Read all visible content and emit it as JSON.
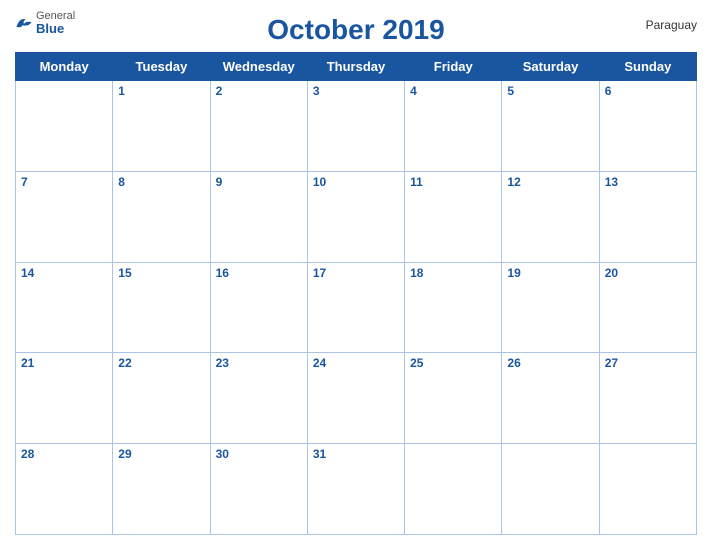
{
  "header": {
    "title": "October 2019",
    "country": "Paraguay",
    "logo": {
      "general": "General",
      "blue": "Blue"
    }
  },
  "weekdays": [
    "Monday",
    "Tuesday",
    "Wednesday",
    "Thursday",
    "Friday",
    "Saturday",
    "Sunday"
  ],
  "weeks": [
    [
      "",
      "1",
      "2",
      "3",
      "4",
      "5",
      "6"
    ],
    [
      "7",
      "8",
      "9",
      "10",
      "11",
      "12",
      "13"
    ],
    [
      "14",
      "15",
      "16",
      "17",
      "18",
      "19",
      "20"
    ],
    [
      "21",
      "22",
      "23",
      "24",
      "25",
      "26",
      "27"
    ],
    [
      "28",
      "29",
      "30",
      "31",
      "",
      "",
      ""
    ]
  ]
}
